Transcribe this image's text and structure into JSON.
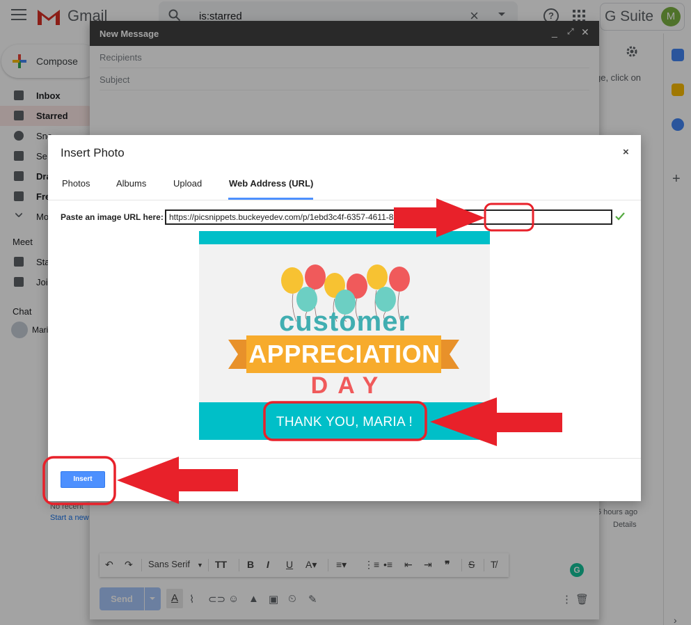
{
  "header": {
    "app_name": "Gmail",
    "search_query": "is:starred",
    "gsuite_label": "G Suite",
    "avatar_initial": "M"
  },
  "sidebar": {
    "compose_label": "Compose",
    "items": [
      {
        "label": "Inbox"
      },
      {
        "label": "Starred"
      },
      {
        "label": "Sno"
      },
      {
        "label": "Se"
      },
      {
        "label": "Dra"
      },
      {
        "label": "Fre"
      },
      {
        "label": "Mo"
      }
    ],
    "meet_heading": "Meet",
    "meet_items": [
      {
        "label": "Sta"
      },
      {
        "label": "Joi"
      }
    ],
    "chat_heading": "Chat",
    "chat_contact": "Mari",
    "no_recent": "No recent",
    "start_new": "Start a new"
  },
  "background": {
    "hint_text": "ge, click on",
    "hours_ago": "5 hours ago",
    "details": "Details"
  },
  "compose": {
    "title": "New Message",
    "recipients_placeholder": "Recipients",
    "subject_placeholder": "Subject",
    "send_label": "Send",
    "font_name": "Sans Serif",
    "grammarly_letter": "G"
  },
  "dialog": {
    "title": "Insert Photo",
    "close_symbol": "×",
    "tabs": [
      {
        "label": "Photos"
      },
      {
        "label": "Albums"
      },
      {
        "label": "Upload"
      },
      {
        "label": "Web Address (URL)"
      }
    ],
    "url_label": "Paste an image URL here:",
    "url_value": "https://picsnippets.buckeyedev.com/p/1ebd3c4f-6357-4611-8                    T=MARIA",
    "insert_label": "Insert"
  },
  "image": {
    "line1": "customer",
    "line2": "APPRECIATION",
    "line3": "DAY",
    "thanks": "THANK YOU,  MARIA !"
  },
  "colors": {
    "teal": "#00bfc8",
    "annotation_red": "#e8212a",
    "primary_blue": "#4d90fe"
  }
}
